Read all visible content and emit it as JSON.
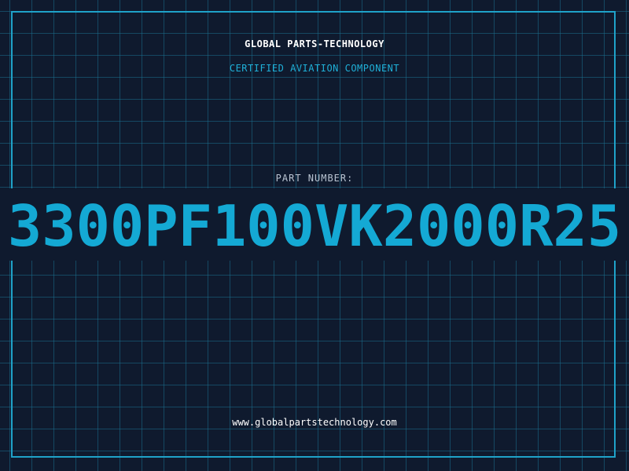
{
  "header": {
    "company": "GLOBAL PARTS-TECHNOLOGY",
    "tagline": "CERTIFIED AVIATION COMPONENT"
  },
  "part": {
    "label": "PART NUMBER:",
    "number": "3300PF100VK2000R25"
  },
  "footer": {
    "website": "www.globalpartstechnology.com"
  },
  "colors": {
    "background": "#0f1a2e",
    "grid": "#1a6e8c",
    "accent": "#14a9d4",
    "text": "#ffffff",
    "label": "#b9c4d2"
  }
}
